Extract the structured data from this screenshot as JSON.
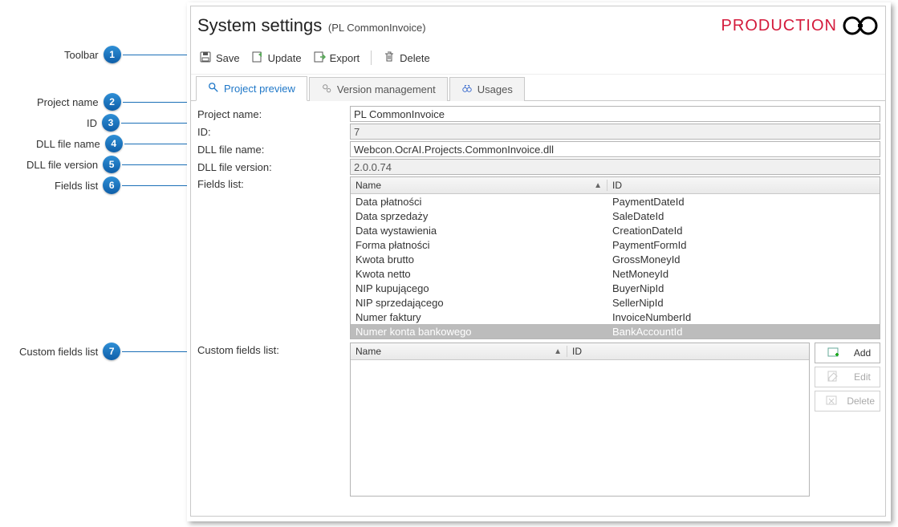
{
  "callouts": [
    {
      "num": "1",
      "label": "Toolbar"
    },
    {
      "num": "2",
      "label": "Project name"
    },
    {
      "num": "3",
      "label": "ID"
    },
    {
      "num": "4",
      "label": "DLL file name"
    },
    {
      "num": "5",
      "label": "DLL file version"
    },
    {
      "num": "6",
      "label": "Fields list"
    },
    {
      "num": "7",
      "label": "Custom fields list"
    }
  ],
  "header": {
    "title": "System settings",
    "subtitle": "(PL CommonInvoice)",
    "brand": "PRODUCTION"
  },
  "toolbar": {
    "save": "Save",
    "update": "Update",
    "export": "Export",
    "delete": "Delete"
  },
  "tabs": {
    "preview": "Project preview",
    "version": "Version management",
    "usages": "Usages"
  },
  "form": {
    "project_name_label": "Project name:",
    "project_name_value": "PL CommonInvoice",
    "id_label": "ID:",
    "id_value": "7",
    "dll_name_label": "DLL file name:",
    "dll_name_value": "Webcon.OcrAI.Projects.CommonInvoice.dll",
    "dll_ver_label": "DLL file version:",
    "dll_ver_value": "2.0.0.74",
    "fields_label": "Fields list:",
    "custom_label": "Custom fields list:"
  },
  "fields_grid": {
    "col_name": "Name",
    "col_id": "ID",
    "rows": [
      {
        "name": "Data płatności",
        "id": "PaymentDateId"
      },
      {
        "name": "Data sprzedaży",
        "id": "SaleDateId"
      },
      {
        "name": "Data wystawienia",
        "id": "CreationDateId"
      },
      {
        "name": "Forma płatności",
        "id": "PaymentFormId"
      },
      {
        "name": "Kwota brutto",
        "id": "GrossMoneyId"
      },
      {
        "name": "Kwota netto",
        "id": "NetMoneyId"
      },
      {
        "name": "NIP kupującego",
        "id": "BuyerNipId"
      },
      {
        "name": "NIP sprzedającego",
        "id": "SellerNipId"
      },
      {
        "name": "Numer faktury",
        "id": "InvoiceNumberId"
      },
      {
        "name": "Numer konta bankowego",
        "id": "BankAccountId"
      }
    ],
    "selected_index": 9
  },
  "custom_grid": {
    "col_name": "Name",
    "col_id": "ID",
    "btn_add": "Add",
    "btn_edit": "Edit",
    "btn_delete": "Delete"
  }
}
